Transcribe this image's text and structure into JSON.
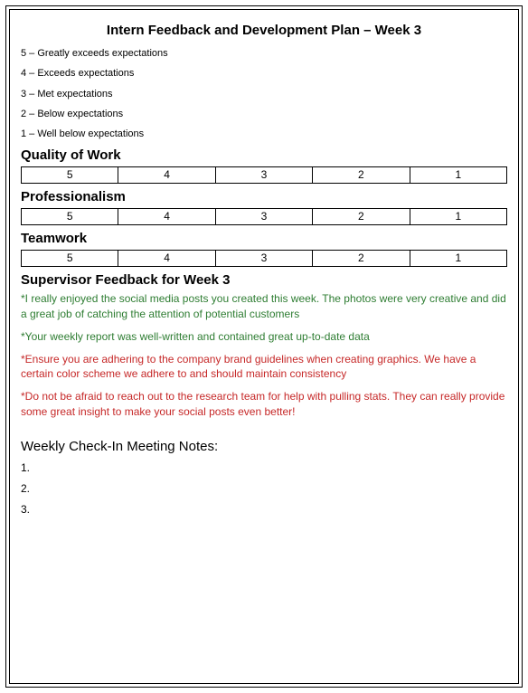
{
  "title": "Intern Feedback and Development Plan – Week 3",
  "legend": [
    "5 – Greatly exceeds expectations",
    "4 – Exceeds expectations",
    "3 – Met expectations",
    "2 – Below expectations",
    "1 – Well below expectations"
  ],
  "ratingScale": [
    "5",
    "4",
    "3",
    "2",
    "1"
  ],
  "sections": [
    {
      "heading": "Quality of Work"
    },
    {
      "heading": "Professionalism"
    },
    {
      "heading": "Teamwork"
    }
  ],
  "feedbackHeading": "Supervisor Feedback for Week 3",
  "feedback": [
    {
      "color": "green",
      "text": "*I really enjoyed the social media posts you created this week. The photos were very creative and did a great job of catching the attention of potential customers"
    },
    {
      "color": "green",
      "text": "*Your weekly report was well-written and contained great up-to-date data"
    },
    {
      "color": "red",
      "text": "*Ensure you are adhering to the company brand guidelines when creating graphics. We have a certain color scheme we adhere to and should maintain consistency"
    },
    {
      "color": "red",
      "text": "*Do not be afraid to reach out to the research team for help with pulling stats. They can really provide some great insight to make your social posts even better!"
    }
  ],
  "notesHeading": "Weekly Check-In Meeting Notes:",
  "notes": [
    "1.",
    "2.",
    "3."
  ]
}
